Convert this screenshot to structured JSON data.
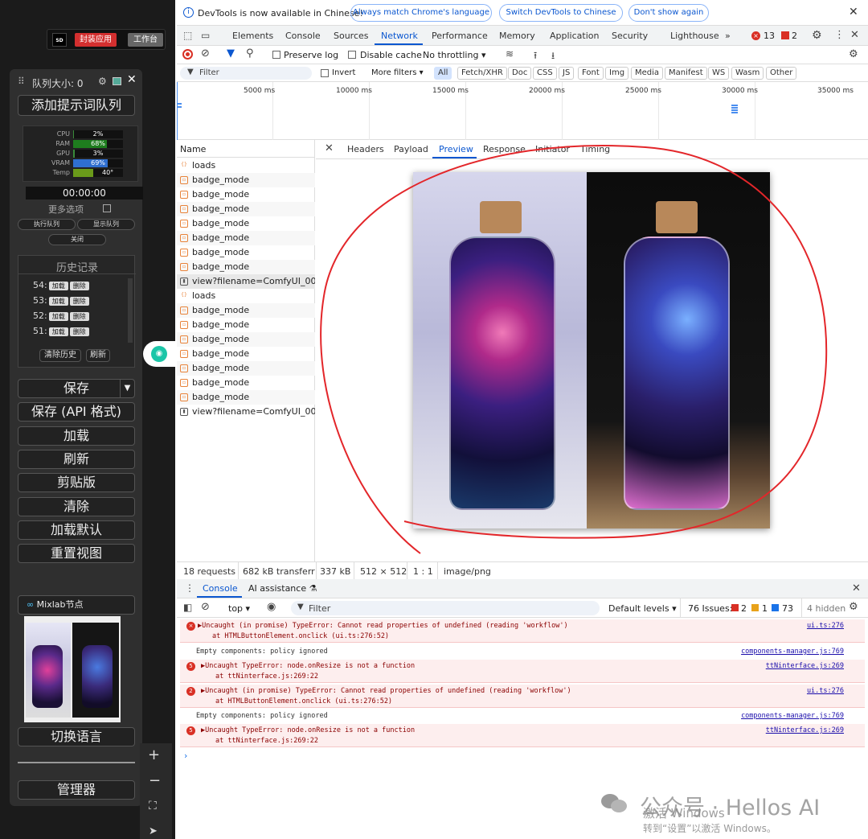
{
  "comfy": {
    "sd_logo": "SD",
    "top_red": "封装应用",
    "top_gray": "工作台",
    "queue_size_label": "队列大小: 0",
    "add_prompt": "添加提示词队列",
    "stats": [
      {
        "label": "CPU",
        "value": "2%",
        "fill": 0.02,
        "color": "#3a8a3a"
      },
      {
        "label": "RAM",
        "value": "68%",
        "fill": 0.68,
        "color": "#1e7d1e"
      },
      {
        "label": "GPU",
        "value": "3%",
        "fill": 0.03,
        "color": "#3a8a3a"
      },
      {
        "label": "VRAM",
        "value": "69%",
        "fill": 0.69,
        "color": "#2f6fd0"
      },
      {
        "label": "Temp",
        "value": "40°",
        "fill": 0.4,
        "color": "#6a9a1a"
      }
    ],
    "timer": "00:00:00",
    "more_options": "更多选项",
    "run_queue": "执行队列",
    "show_queue": "显示队列",
    "close": "关闭",
    "history_title": "历史记录",
    "history": [
      {
        "num": "54:",
        "load": "加载",
        "del": "删除"
      },
      {
        "num": "53:",
        "load": "加载",
        "del": "删除"
      },
      {
        "num": "52:",
        "load": "加载",
        "del": "删除"
      },
      {
        "num": "51:",
        "load": "加载",
        "del": "删除"
      }
    ],
    "clear_history": "清除历史",
    "refresh_small": "刷新",
    "save": "保存",
    "save_api": "保存 (API 格式)",
    "load": "加载",
    "refresh": "刷新",
    "clipspace": "剪贴版",
    "clear": "清除",
    "load_default": "加载默认",
    "reset_view": "重置视图",
    "mixlab": "Mixlab节点",
    "switch_lang": "切换语言",
    "manager": "管理器"
  },
  "devtools": {
    "info_text": "DevTools is now available in Chinese!",
    "info_btn1": "Always match Chrome's language",
    "info_btn2": "Switch DevTools to Chinese",
    "info_btn3": "Don't show again",
    "tabs": [
      "Elements",
      "Console",
      "Sources",
      "Network",
      "Performance",
      "Memory",
      "Application",
      "Security",
      "Lighthouse"
    ],
    "active_tab": "Network",
    "errors_count": "13",
    "warn_count": "2",
    "preserve_log": "Preserve log",
    "disable_cache": "Disable cache",
    "throttling": "No throttling",
    "filter_placeholder": "Filter",
    "invert": "Invert",
    "more_filters": "More filters",
    "filter_types": [
      "All",
      "Fetch/XHR",
      "Doc",
      "CSS",
      "JS",
      "Font",
      "Img",
      "Media",
      "Manifest",
      "WS",
      "Wasm",
      "Other"
    ],
    "timeline_ticks": [
      "5000 ms",
      "10000 ms",
      "15000 ms",
      "20000 ms",
      "25000 ms",
      "30000 ms",
      "35000 ms"
    ],
    "name_header": "Name",
    "requests": [
      {
        "name": "loads",
        "kind": "json"
      },
      {
        "name": "badge_mode",
        "kind": "doc"
      },
      {
        "name": "badge_mode",
        "kind": "doc"
      },
      {
        "name": "badge_mode",
        "kind": "doc"
      },
      {
        "name": "badge_mode",
        "kind": "doc"
      },
      {
        "name": "badge_mode",
        "kind": "doc"
      },
      {
        "name": "badge_mode",
        "kind": "doc"
      },
      {
        "name": "badge_mode",
        "kind": "doc"
      },
      {
        "name": "view?filename=ComfyUI_00...",
        "kind": "img"
      },
      {
        "name": "loads",
        "kind": "json"
      },
      {
        "name": "badge_mode",
        "kind": "doc"
      },
      {
        "name": "badge_mode",
        "kind": "doc"
      },
      {
        "name": "badge_mode",
        "kind": "doc"
      },
      {
        "name": "badge_mode",
        "kind": "doc"
      },
      {
        "name": "badge_mode",
        "kind": "doc"
      },
      {
        "name": "badge_mode",
        "kind": "doc"
      },
      {
        "name": "badge_mode",
        "kind": "doc"
      },
      {
        "name": "view?filename=ComfyUI_00...",
        "kind": "img"
      }
    ],
    "panel_tabs": [
      "Headers",
      "Payload",
      "Preview",
      "Response",
      "Initiator",
      "Timing"
    ],
    "active_panel_tab": "Preview",
    "status": {
      "requests": "18 requests",
      "transferred": "682 kB transferred",
      "size": "337 kB",
      "dims": "512 × 512",
      "ratio": "1 : 1",
      "mime": "image/png"
    },
    "console_tab": "Console",
    "ai_tab": "AI assistance",
    "context": "top",
    "console_filter": "Filter",
    "default_levels": "Default levels",
    "issues_label": "76 Issues:",
    "issues_err": "2",
    "issues_warn": "1",
    "issues_info": "73",
    "hidden": "4 hidden",
    "logs": [
      {
        "type": "error",
        "badge": "×",
        "line1": "▶Uncaught (in promise) TypeError: Cannot read properties of undefined (reading 'workflow')",
        "line2": "at HTMLButtonElement.onclick (ui.ts:276:52)",
        "src": "ui.ts:276"
      },
      {
        "type": "info",
        "line1": "Empty components: policy ignored",
        "src": "components-manager.js:769"
      },
      {
        "type": "error",
        "badge": "5",
        "line1": "▶Uncaught TypeError: node.onResize is not a function",
        "line2": "at ttNinterface.js:269:22",
        "src": "ttNinterface.js:269"
      },
      {
        "type": "error",
        "badge": "2",
        "line1": "▶Uncaught (in promise) TypeError: Cannot read properties of undefined (reading 'workflow')",
        "line2": "at HTMLButtonElement.onclick (ui.ts:276:52)",
        "src": "ui.ts:276"
      },
      {
        "type": "info",
        "line1": "Empty components: policy ignored",
        "src": "components-manager.js:769"
      },
      {
        "type": "error",
        "badge": "5",
        "line1": "▶Uncaught TypeError: node.onResize is not a function",
        "line2": "at ttNinterface.js:269:22",
        "src": "ttNinterface.js:269"
      }
    ]
  },
  "watermark": {
    "wechat": "公众号 · Hellos AI",
    "win1": "激活 Windows",
    "win2": "转到“设置”以激活 Windows。"
  }
}
